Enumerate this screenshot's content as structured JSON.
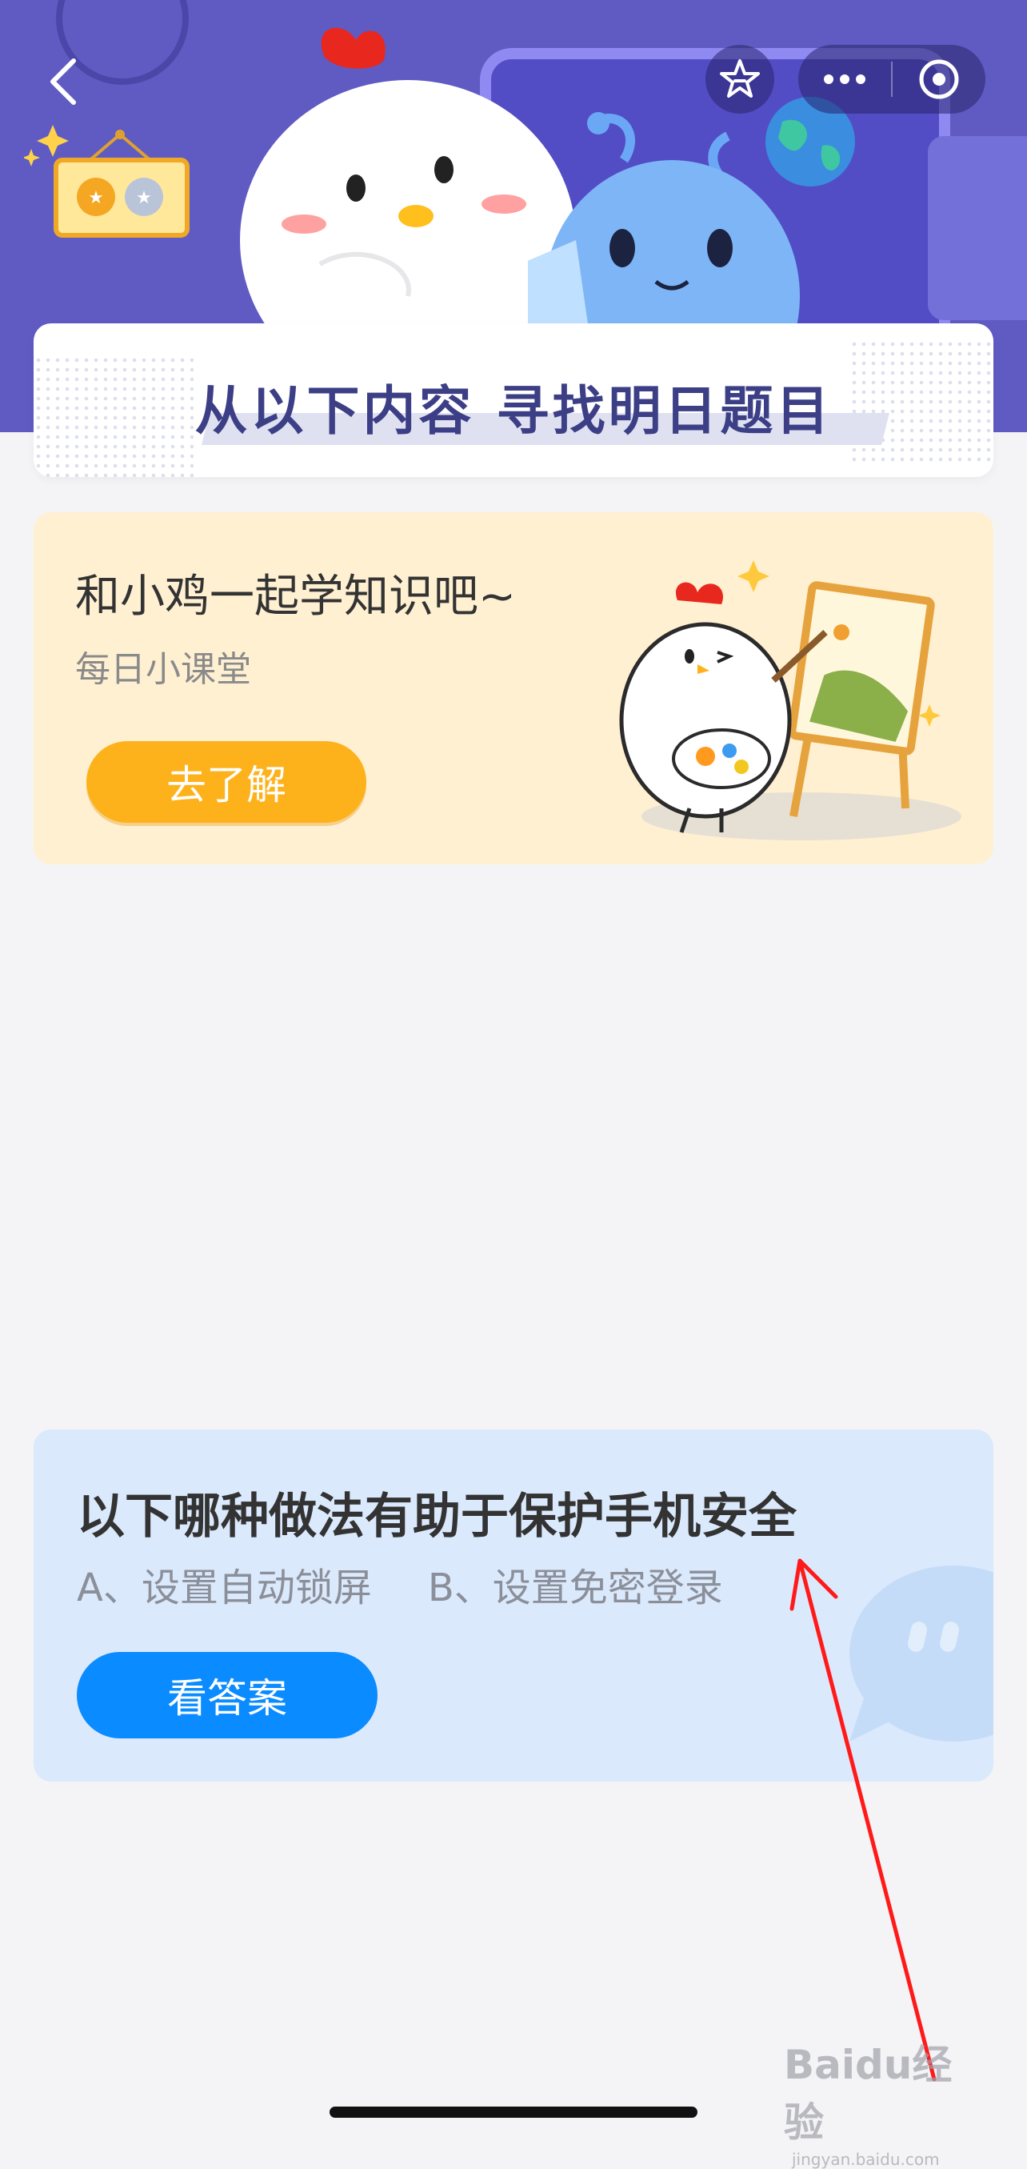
{
  "header": {
    "back_icon": "chevron-left-icon",
    "favorite_icon": "star-icon",
    "more_icon": "more-dots-icon",
    "close_icon": "target-circle-icon"
  },
  "section_banner": {
    "title": "从以下内容  寻找明日题目"
  },
  "learn_card": {
    "title": "和小鸡一起学知识吧~",
    "subtitle": "每日小课堂",
    "button_label": "去了解"
  },
  "quiz_card": {
    "question": "以下哪种做法有助于保护手机安全",
    "option_a": "A、设置自动锁屏",
    "option_b": "B、设置免密登录",
    "button_label": "看答案"
  },
  "watermark": {
    "main": "Baidu经验",
    "sub": "jingyan.baidu.com"
  },
  "colors": {
    "hero_bg": "#5f5bc2",
    "learn_card_bg": "#fff0d2",
    "learn_button": "#fdb21c",
    "quiz_card_bg": "#dbe9fc",
    "quiz_button": "#0a8bff",
    "annotation_arrow": "#ff1a1a"
  }
}
